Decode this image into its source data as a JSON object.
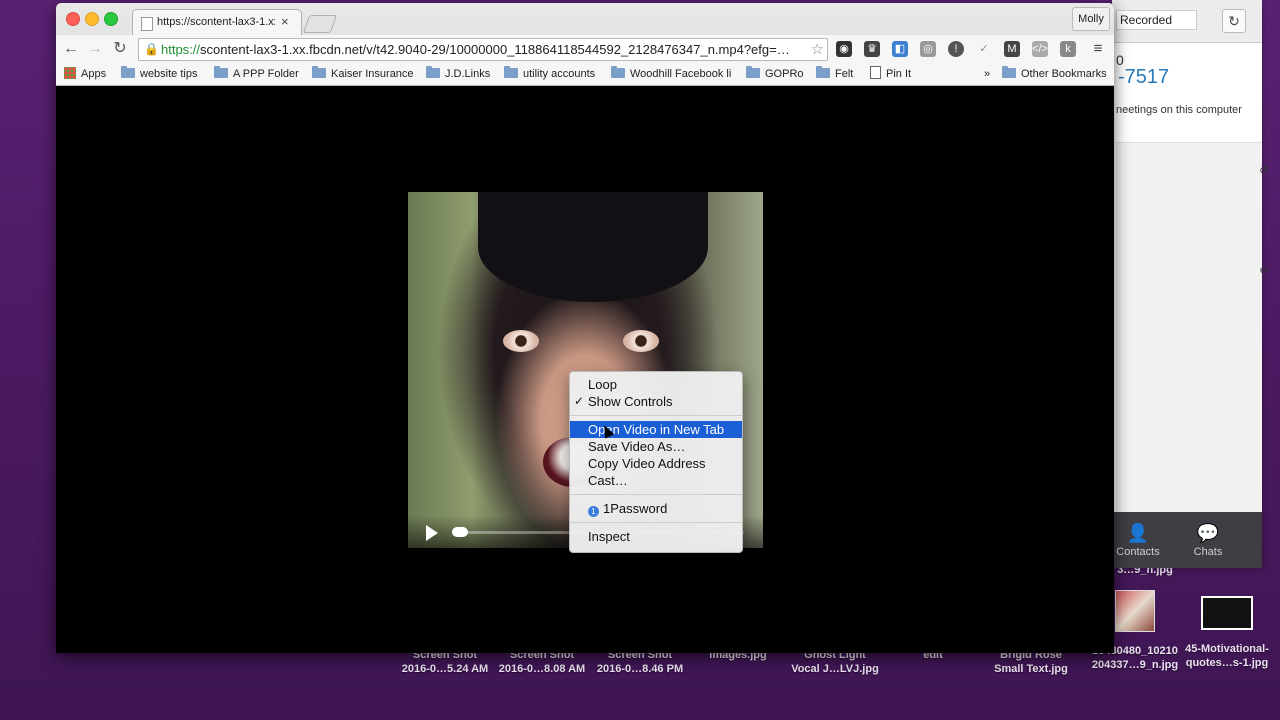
{
  "browser": {
    "tab_title": "https://scontent-lax3-1.xx.fbcdn.net/v/t42",
    "profile": "Molly",
    "url_scheme": "https://",
    "url_rest": "scontent-lax3-1.xx.fbcdn.net/v/t42.9040-29/10000000_118864118544592_2128476347_n.mp4?efg=…",
    "bookmarks": [
      "Apps",
      "website tips",
      "A PPP Folder",
      "Kaiser Insurance",
      "J.D.Links",
      "utility accounts",
      "Woodhill Facebook li",
      "GOPRo",
      "Felt",
      "Pin It"
    ],
    "bookmarks_overflow": "»",
    "other_bookmarks": "Other Bookmarks"
  },
  "context_menu": {
    "items": [
      "Loop",
      "Show Controls",
      "Open Video in New Tab",
      "Save Video As…",
      "Copy Video Address",
      "Cast…",
      "1Password",
      "Inspect"
    ],
    "checked": "✓"
  },
  "side_panel": {
    "recorded": "Recorded",
    "number_top": "0",
    "number": "-7517",
    "meeting_text": "neetings on this computer",
    "tab_contacts": "Contacts",
    "tab_chats": "Chats",
    "edge1": "df",
    "edge2": "er"
  },
  "desktop": {
    "files": [
      {
        "line1": "Screen Shot",
        "line2": "2016-0…5.24 AM"
      },
      {
        "line1": "Screen Shot",
        "line2": "2016-0…8.08 AM"
      },
      {
        "line1": "Screen Shot",
        "line2": "2016-0…8.46 PM"
      },
      {
        "line1": "images.jpg",
        "line2": ""
      },
      {
        "line1": "Ghost Light",
        "line2": "Vocal J…LVJ.jpg"
      },
      {
        "line1": "edit",
        "line2": ""
      },
      {
        "line1": "Brigid Rose",
        "line2": "Small Text.jpg"
      },
      {
        "line1": "13480480_10210",
        "line2": "204337…9_n.jpg"
      },
      {
        "line1": "45-Motivational-",
        "line2": "quotes…s-1.jpg"
      }
    ],
    "partial_file": "3…9_n.jpg"
  }
}
